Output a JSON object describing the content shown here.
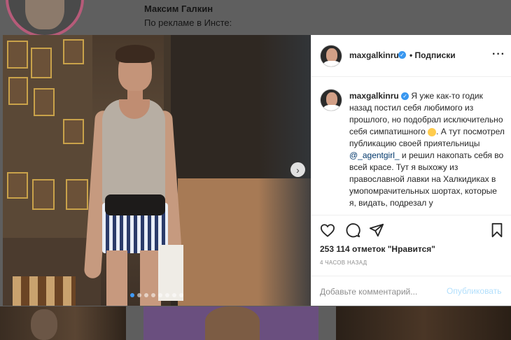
{
  "background_post": {
    "author_name": "Максим Галкин",
    "author_text": "По рекламе в Инсте:"
  },
  "header": {
    "username": "maxgalkinru",
    "separator": "•",
    "follow_label": "Подписки",
    "more_icon": "more-horizontal-icon",
    "verified_icon": "verified-badge-icon"
  },
  "caption": {
    "username": "maxgalkinru",
    "text_1": "Я уже как-то годик назад постил себя любимого из прошлого, но подобрал исключительно себя симпатишного",
    "text_2": ". А тут посмотрел публикацию своей приятельницы",
    "mention": "@_agentgirl_",
    "text_3": "и решил накопать себя во всей красе. Тут я выхожу из православной лавки на Халкидиках в умопомрачительных шортах, которые я, видать, подрезал у"
  },
  "actions": {
    "likes_text": "253 114 отметок \"Нравится\"",
    "time_text": "4 ЧАСОВ НАЗАД",
    "comment_placeholder": "Добавьте комментарий...",
    "publish_label": "Опубликовать"
  },
  "carousel": {
    "total": 8,
    "active_index": 0,
    "next_icon": "chevron-right-icon"
  },
  "colors": {
    "accent_blue": "#3897f0",
    "publish_disabled": "#b2dffc",
    "mention_blue": "#00376b"
  }
}
